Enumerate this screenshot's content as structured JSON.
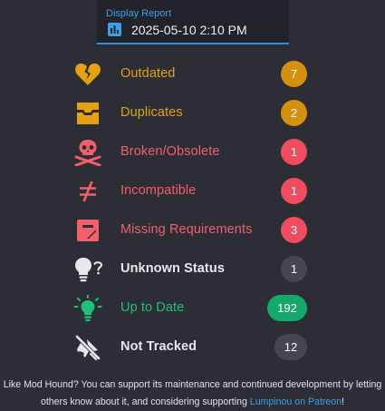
{
  "report": {
    "label": "Display Report",
    "value": "2025-05-10 2:10 PM"
  },
  "statuses": [
    {
      "label": "Outdated",
      "count": "7",
      "icon": "heart-broken-icon",
      "color": "#e3a311",
      "badge": "#d4900e"
    },
    {
      "label": "Duplicates",
      "count": "2",
      "icon": "inbox-duplicate-icon",
      "color": "#e3a311",
      "badge": "#d4900e"
    },
    {
      "label": "Broken/Obsolete",
      "count": "1",
      "icon": "skull-crossbones-icon",
      "color": "#f25f6d",
      "badge": "#ef4d5f"
    },
    {
      "label": "Incompatible",
      "count": "1",
      "icon": "not-equal-icon",
      "color": "#f25f6d",
      "badge": "#ef4d5f"
    },
    {
      "label": "Missing Requirements",
      "count": "3",
      "icon": "missing-puzzle-icon",
      "color": "#f25f6d",
      "badge": "#ef4d5f"
    },
    {
      "label": "Unknown Status",
      "count": "1",
      "icon": "lightbulb-question-icon",
      "color": "#e8e8ec",
      "badge": "#45464f"
    },
    {
      "label": "Up to Date",
      "count": "192",
      "icon": "lightbulb-on-icon",
      "color": "#1fc07a",
      "badge": "#14a86a"
    },
    {
      "label": "Not Tracked",
      "count": "12",
      "icon": "eye-off-icon",
      "color": "#e8e8ec",
      "badge": "#45464f"
    }
  ],
  "footer": {
    "text_before": "Like Mod Hound? You can support its maintenance and continued development by letting others know about it, and considering supporting ",
    "link": "Lumpinou on Patreon",
    "text_after": "!"
  }
}
